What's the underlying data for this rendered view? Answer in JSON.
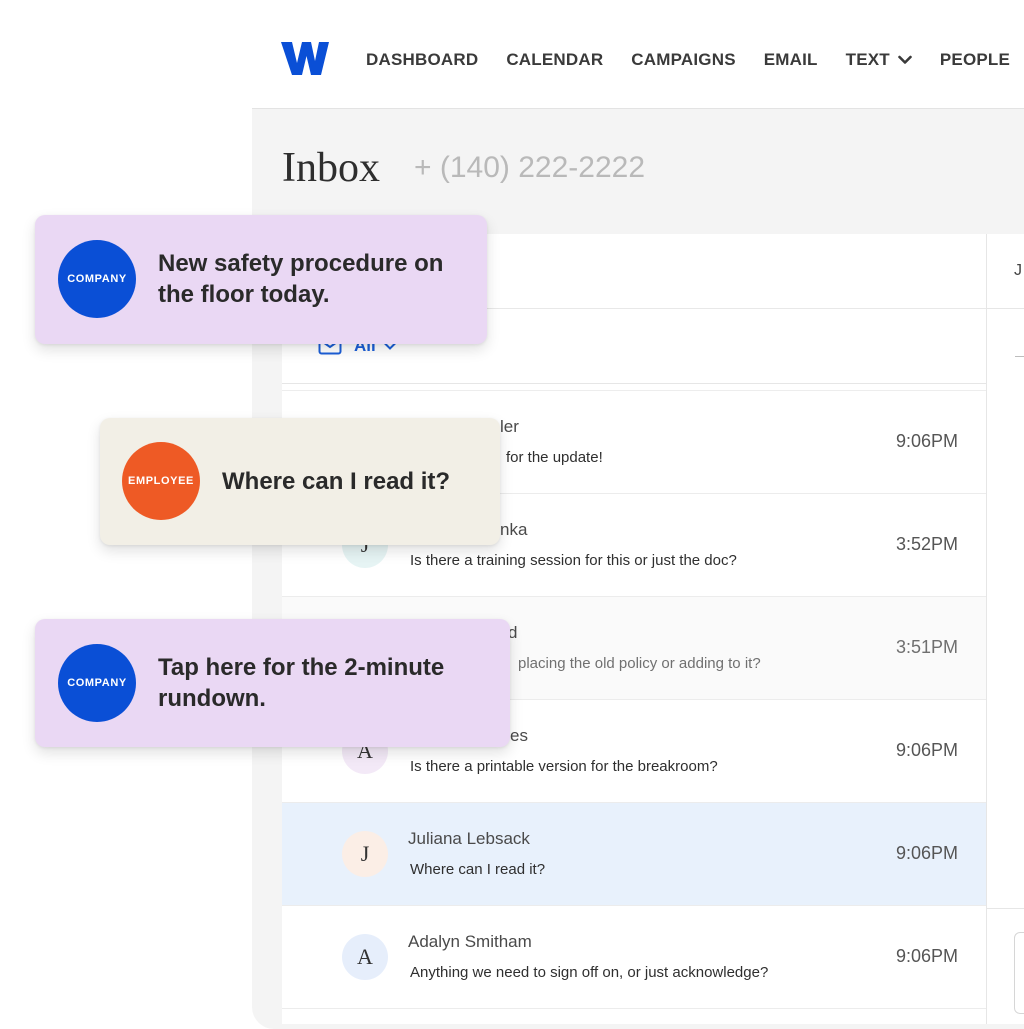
{
  "nav": {
    "logo_letter": "W",
    "items": [
      "DASHBOARD",
      "CALENDAR",
      "CAMPAIGNS",
      "EMAIL",
      "TEXT",
      "PEOPLE"
    ],
    "brand_color": "#0a4fd6"
  },
  "inbox": {
    "title": "Inbox",
    "phone": "+ (140) 222-2222",
    "filter_label": "All",
    "right_header_initial": "J"
  },
  "conversations": [
    {
      "initial": "",
      "name": "ler",
      "message": "for the update!",
      "time": "9:06PM",
      "state": "normal"
    },
    {
      "initial": "J",
      "name": "nka",
      "message": "Is there a training session for this or just the doc?",
      "time": "3:52PM",
      "state": "normal"
    },
    {
      "initial": "",
      "name": "d",
      "message": "placing the old policy or adding to it?",
      "time": "3:51PM",
      "state": "muted"
    },
    {
      "initial": "A",
      "name": "es",
      "message": "Is there a printable version for the breakroom?",
      "time": "9:06PM",
      "state": "normal"
    },
    {
      "initial": "J",
      "name": "Juliana Lebsack",
      "message": "Where can I read it?",
      "time": "9:06PM",
      "state": "selected"
    },
    {
      "initial": "A",
      "name": "Adalyn Smitham",
      "message": "Anything we need to sign off on, or just acknowledge?",
      "time": "9:06PM",
      "state": "normal"
    }
  ],
  "cards": [
    {
      "badge": "COMPANY",
      "text": "New safety procedure on the floor today.",
      "kind": "company"
    },
    {
      "badge": "EMPLOYEE",
      "text": "Where can I read it?",
      "kind": "employee"
    },
    {
      "badge": "COMPANY",
      "text": "Tap here for the 2-minute rundown.",
      "kind": "company"
    }
  ],
  "colors": {
    "company_badge": "#0a4fd6",
    "employee_badge": "#ee5a25",
    "company_card": "#ead8f4",
    "employee_card": "#f2efe6",
    "selected_row": "#e8f1fc",
    "filter_blue": "#1c5fd8"
  }
}
